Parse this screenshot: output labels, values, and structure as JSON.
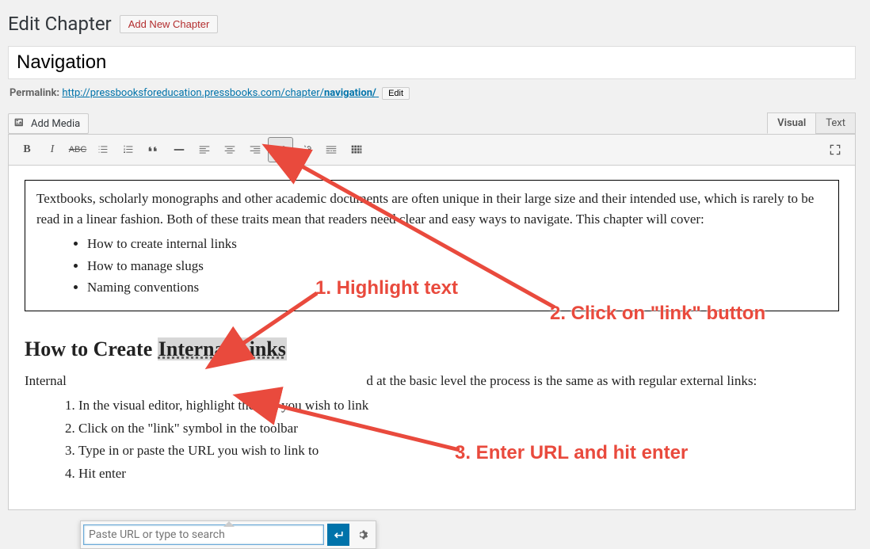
{
  "header": {
    "page_title": "Edit Chapter",
    "add_btn": "Add New Chapter"
  },
  "title_field": "Navigation",
  "permalink": {
    "label": "Permalink:",
    "base": "http://pressbooksforeducation.pressbooks.com/chapter/",
    "slug": "navigation/",
    "edit": "Edit"
  },
  "media_btn": "Add Media",
  "tabs": {
    "visual": "Visual",
    "text": "Text"
  },
  "content": {
    "intro": "Textbooks, scholarly monographs and other academic documents are often unique in their large size and their intended use, which is rarely to be read in a linear fashion. Both of these traits mean that readers need clear and easy ways to navigate. This chapter will cover:",
    "bullets": [
      "How to create internal links",
      "How to manage slugs",
      "Naming conventions"
    ],
    "h2_pre": "How to Create ",
    "h2_hl": "Internal Links",
    "para_pre": "Internal ",
    "para_post": "d at the basic level the process is the same as with regular external  links:",
    "steps": [
      "In the visual editor, highlight the text you wish to link",
      "Click on the \"link\" symbol in the toolbar",
      "Type in or paste the URL you wish to link to",
      "Hit enter"
    ]
  },
  "linkpop": {
    "placeholder": "Paste URL or type to search"
  },
  "annotations": {
    "a1": "1.  Highlight text",
    "a2": "2.  Click on \"link\" button",
    "a3": "3.  Enter URL and hit enter"
  }
}
